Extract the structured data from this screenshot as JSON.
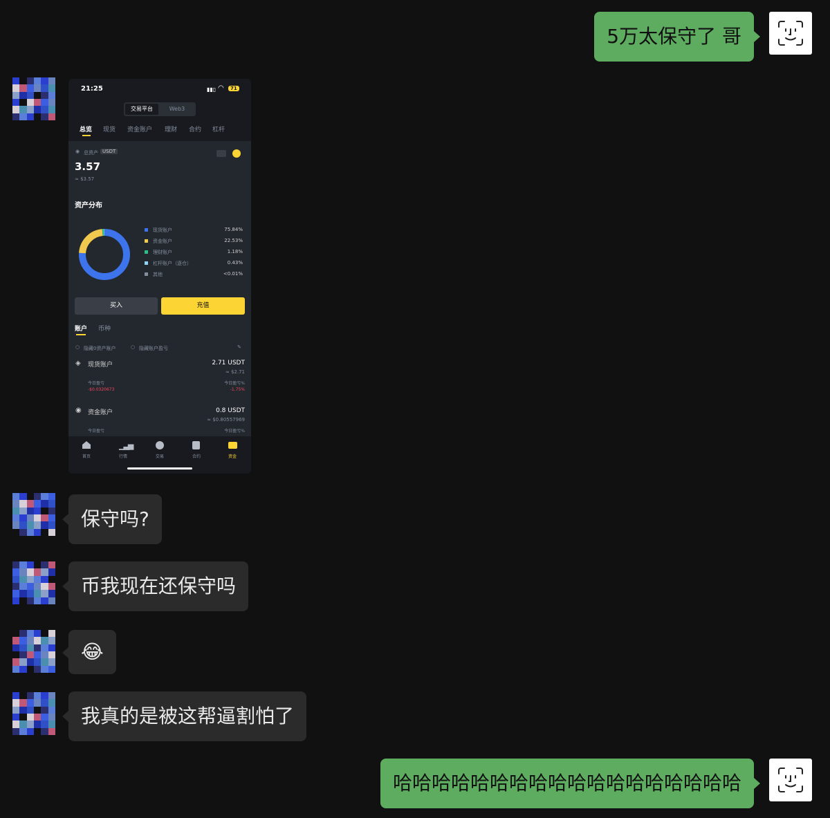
{
  "messages": {
    "m1": "5万太保守了 哥",
    "m3": "保守吗?",
    "m4": "币我现在还保守吗",
    "m5": "😂",
    "m6": "我真的是被这帮逼割怕了",
    "m7": "哈哈哈哈哈哈哈哈哈哈哈哈哈哈哈哈哈哈"
  },
  "phone": {
    "time": "21:25",
    "battery": "71",
    "platform_tabs": [
      "交易平台",
      "Web3"
    ],
    "nav_tabs": [
      "总览",
      "现货",
      "资金账户",
      "理财",
      "合约",
      "杠杆"
    ],
    "total_label": "总资产",
    "currency": "USDT",
    "total_value": "3.57",
    "total_usd": "≈ $3.57",
    "distribution_title": "资产分布",
    "buy_label": "买入",
    "deposit_label": "充值",
    "list_tabs": [
      "账户",
      "币种"
    ],
    "hide_zero": "隐藏0资产账户",
    "hide_pnl": "隐藏账户盈亏",
    "spot_account": {
      "name": "现货账户",
      "amount": "2.71 USDT",
      "usd": "≈ $2.71",
      "pnl_label": "今日盈亏",
      "pnl_value": "-$0.0320673",
      "pnl_pct_label": "今日盈亏%",
      "pnl_pct": "-1.75%"
    },
    "fund_account": {
      "name": "资金账户",
      "amount": "0.8 USDT",
      "usd": "≈ $0.80557969",
      "pnl_label": "今日盈亏",
      "pnl_pct_label": "今日盈亏%"
    },
    "bottom_nav": [
      "首页",
      "行情",
      "交易",
      "合约",
      "资金"
    ]
  },
  "chart_data": {
    "type": "pie",
    "categories": [
      "现货账户",
      "资金账户",
      "理财账户",
      "杠杆账户（逐仓）",
      "其他"
    ],
    "values": [
      75.84,
      22.53,
      1.18,
      0.43,
      0.01
    ],
    "value_labels": [
      "75.84%",
      "22.53%",
      "1.18%",
      "0.43%",
      "<0.01%"
    ],
    "colors": [
      "#3d73eb",
      "#f0c94e",
      "#2ebd85",
      "#8fd3f5",
      "#848e9c"
    ],
    "donut": true
  },
  "colors": {
    "background": "#111111",
    "bubble_other": "#2b2b2b",
    "bubble_mine": "#5dac60",
    "accent_yellow": "#fcd535"
  },
  "icons": {
    "me_avatar": "face-id-icon"
  }
}
